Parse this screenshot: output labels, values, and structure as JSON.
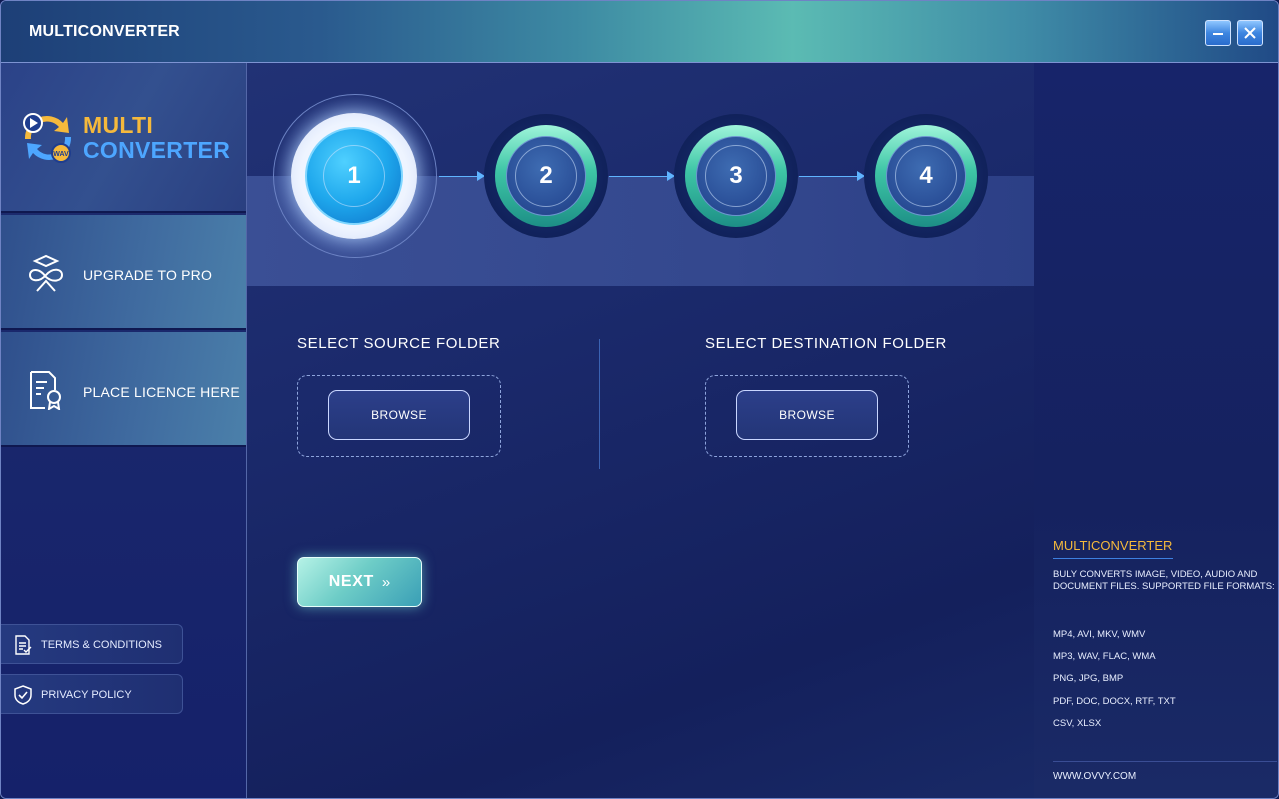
{
  "window": {
    "title": "MULTICONVERTER",
    "minimize_icon": "minimize-icon",
    "close_icon": "close-icon"
  },
  "sidebar": {
    "logo": {
      "line1": "MULTI",
      "line2": "CONVERTER",
      "badge": "WAV"
    },
    "items": [
      {
        "label": "UPGRADE TO PRO",
        "icon": "infinity-cap-icon"
      },
      {
        "label": "PLACE LICENCE HERE",
        "icon": "licence-document-icon"
      }
    ],
    "links": [
      {
        "label": "TERMS & CONDITIONS",
        "icon": "document-icon"
      },
      {
        "label": "PRIVACY POLICY",
        "icon": "shield-check-icon"
      }
    ]
  },
  "stepper": {
    "steps": [
      "1",
      "2",
      "3",
      "4"
    ],
    "active": 1
  },
  "source": {
    "title": "SELECT SOURCE FOLDER",
    "button": "BROWSE"
  },
  "destination": {
    "title": "SELECT DESTINATION FOLDER",
    "button": "BROWSE"
  },
  "next": {
    "label": "NEXT",
    "arrows": "»"
  },
  "info": {
    "title": "MULTICONVERTER",
    "description": "BULY CONVERTS IMAGE, VIDEO, AUDIO AND DOCUMENT FILES. SUPPORTED FILE FORMATS:",
    "formats": [
      "MP4, AVI, MKV, WMV",
      "MP3, WAV, FLAC, WMA",
      "PNG, JPG, BMP",
      "PDF, DOC, DOCX, RTF, TXT",
      "CSV, XLSX"
    ],
    "url": "WWW.OVVY.COM"
  },
  "colors": {
    "accent_gold": "#f5b93c",
    "accent_blue": "#4da6ff",
    "background": "#1b2a6c"
  }
}
